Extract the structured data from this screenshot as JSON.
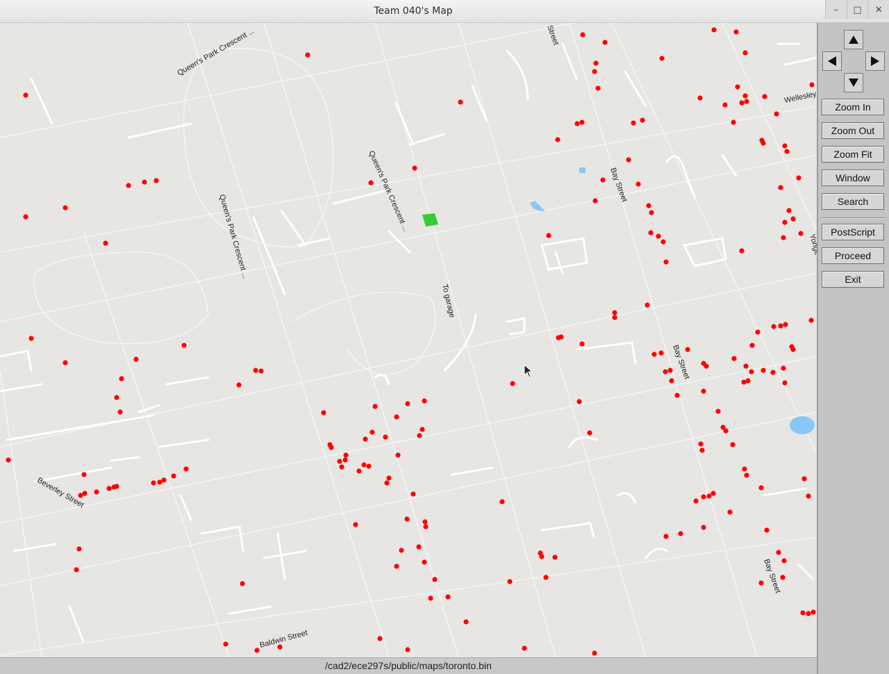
{
  "window": {
    "title": "Team 040's Map"
  },
  "wm_controls": [
    "minimize-icon",
    "maximize-icon",
    "close-icon"
  ],
  "map": {
    "street_labels": [
      "Queen's Park Crescent ...",
      "Queen's Park Crescent ...",
      "Queen's Park Crescent ...",
      "To garage",
      "Bay Street",
      "Bay Street",
      "Bay Street",
      "Wellesley",
      "Yonge",
      "Beverley Street",
      "Baldwin Street",
      "Street"
    ],
    "colors": {
      "background": "#e8e6e3",
      "road": "#ffffff",
      "poi": "#ff0000",
      "water": "#88c8f8",
      "park": "#33cc33"
    }
  },
  "nav_arrows": [
    "up-arrow-icon",
    "left-arrow-icon",
    "right-arrow-icon",
    "down-arrow-icon"
  ],
  "buttons": {
    "zoom_in": "Zoom In",
    "zoom_out": "Zoom Out",
    "zoom_fit": "Zoom Fit",
    "window": "Window",
    "search": "Search",
    "postscript": "PostScript",
    "proceed": "Proceed",
    "exit": "Exit"
  },
  "status": {
    "path": "/cad2/ece297s/public/maps/toronto.bin"
  }
}
